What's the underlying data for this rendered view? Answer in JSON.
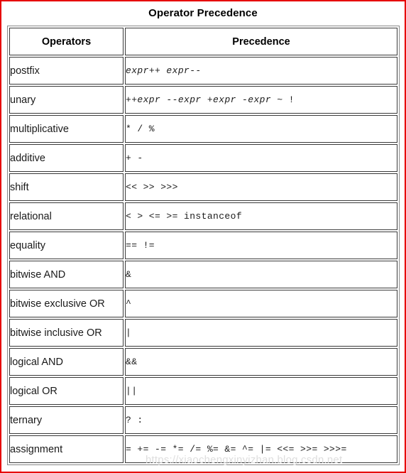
{
  "page": {
    "title": "Operator Precedence",
    "watermark": "https://xiaochengxinyizhan.blog.csdn.net",
    "frame_color": "#e60000",
    "border_color": "#3a3a3a",
    "background": "#ffffff"
  },
  "table": {
    "columns": [
      {
        "key": "operators",
        "label": "Operators"
      },
      {
        "key": "precedence",
        "label": "Precedence"
      }
    ],
    "rows": [
      {
        "operators": "postfix",
        "precedence": "expr++ expr--"
      },
      {
        "operators": "unary",
        "precedence": "++expr --expr +expr -expr ~ !"
      },
      {
        "operators": "multiplicative",
        "precedence": "* / %"
      },
      {
        "operators": "additive",
        "precedence": "+ -"
      },
      {
        "operators": "shift",
        "precedence": "<< >> >>>"
      },
      {
        "operators": "relational",
        "precedence": "< > <= >= instanceof"
      },
      {
        "operators": "equality",
        "precedence": "== !="
      },
      {
        "operators": "bitwise AND",
        "precedence": "&"
      },
      {
        "operators": "bitwise exclusive OR",
        "precedence": "^"
      },
      {
        "operators": "bitwise inclusive OR",
        "precedence": "|"
      },
      {
        "operators": "logical AND",
        "precedence": "&&"
      },
      {
        "operators": "logical OR",
        "precedence": "||"
      },
      {
        "operators": "ternary",
        "precedence": "? :"
      },
      {
        "operators": "assignment",
        "precedence": "= += -= *= /= %= &= ^= |= <<= >>= >>>="
      }
    ]
  }
}
